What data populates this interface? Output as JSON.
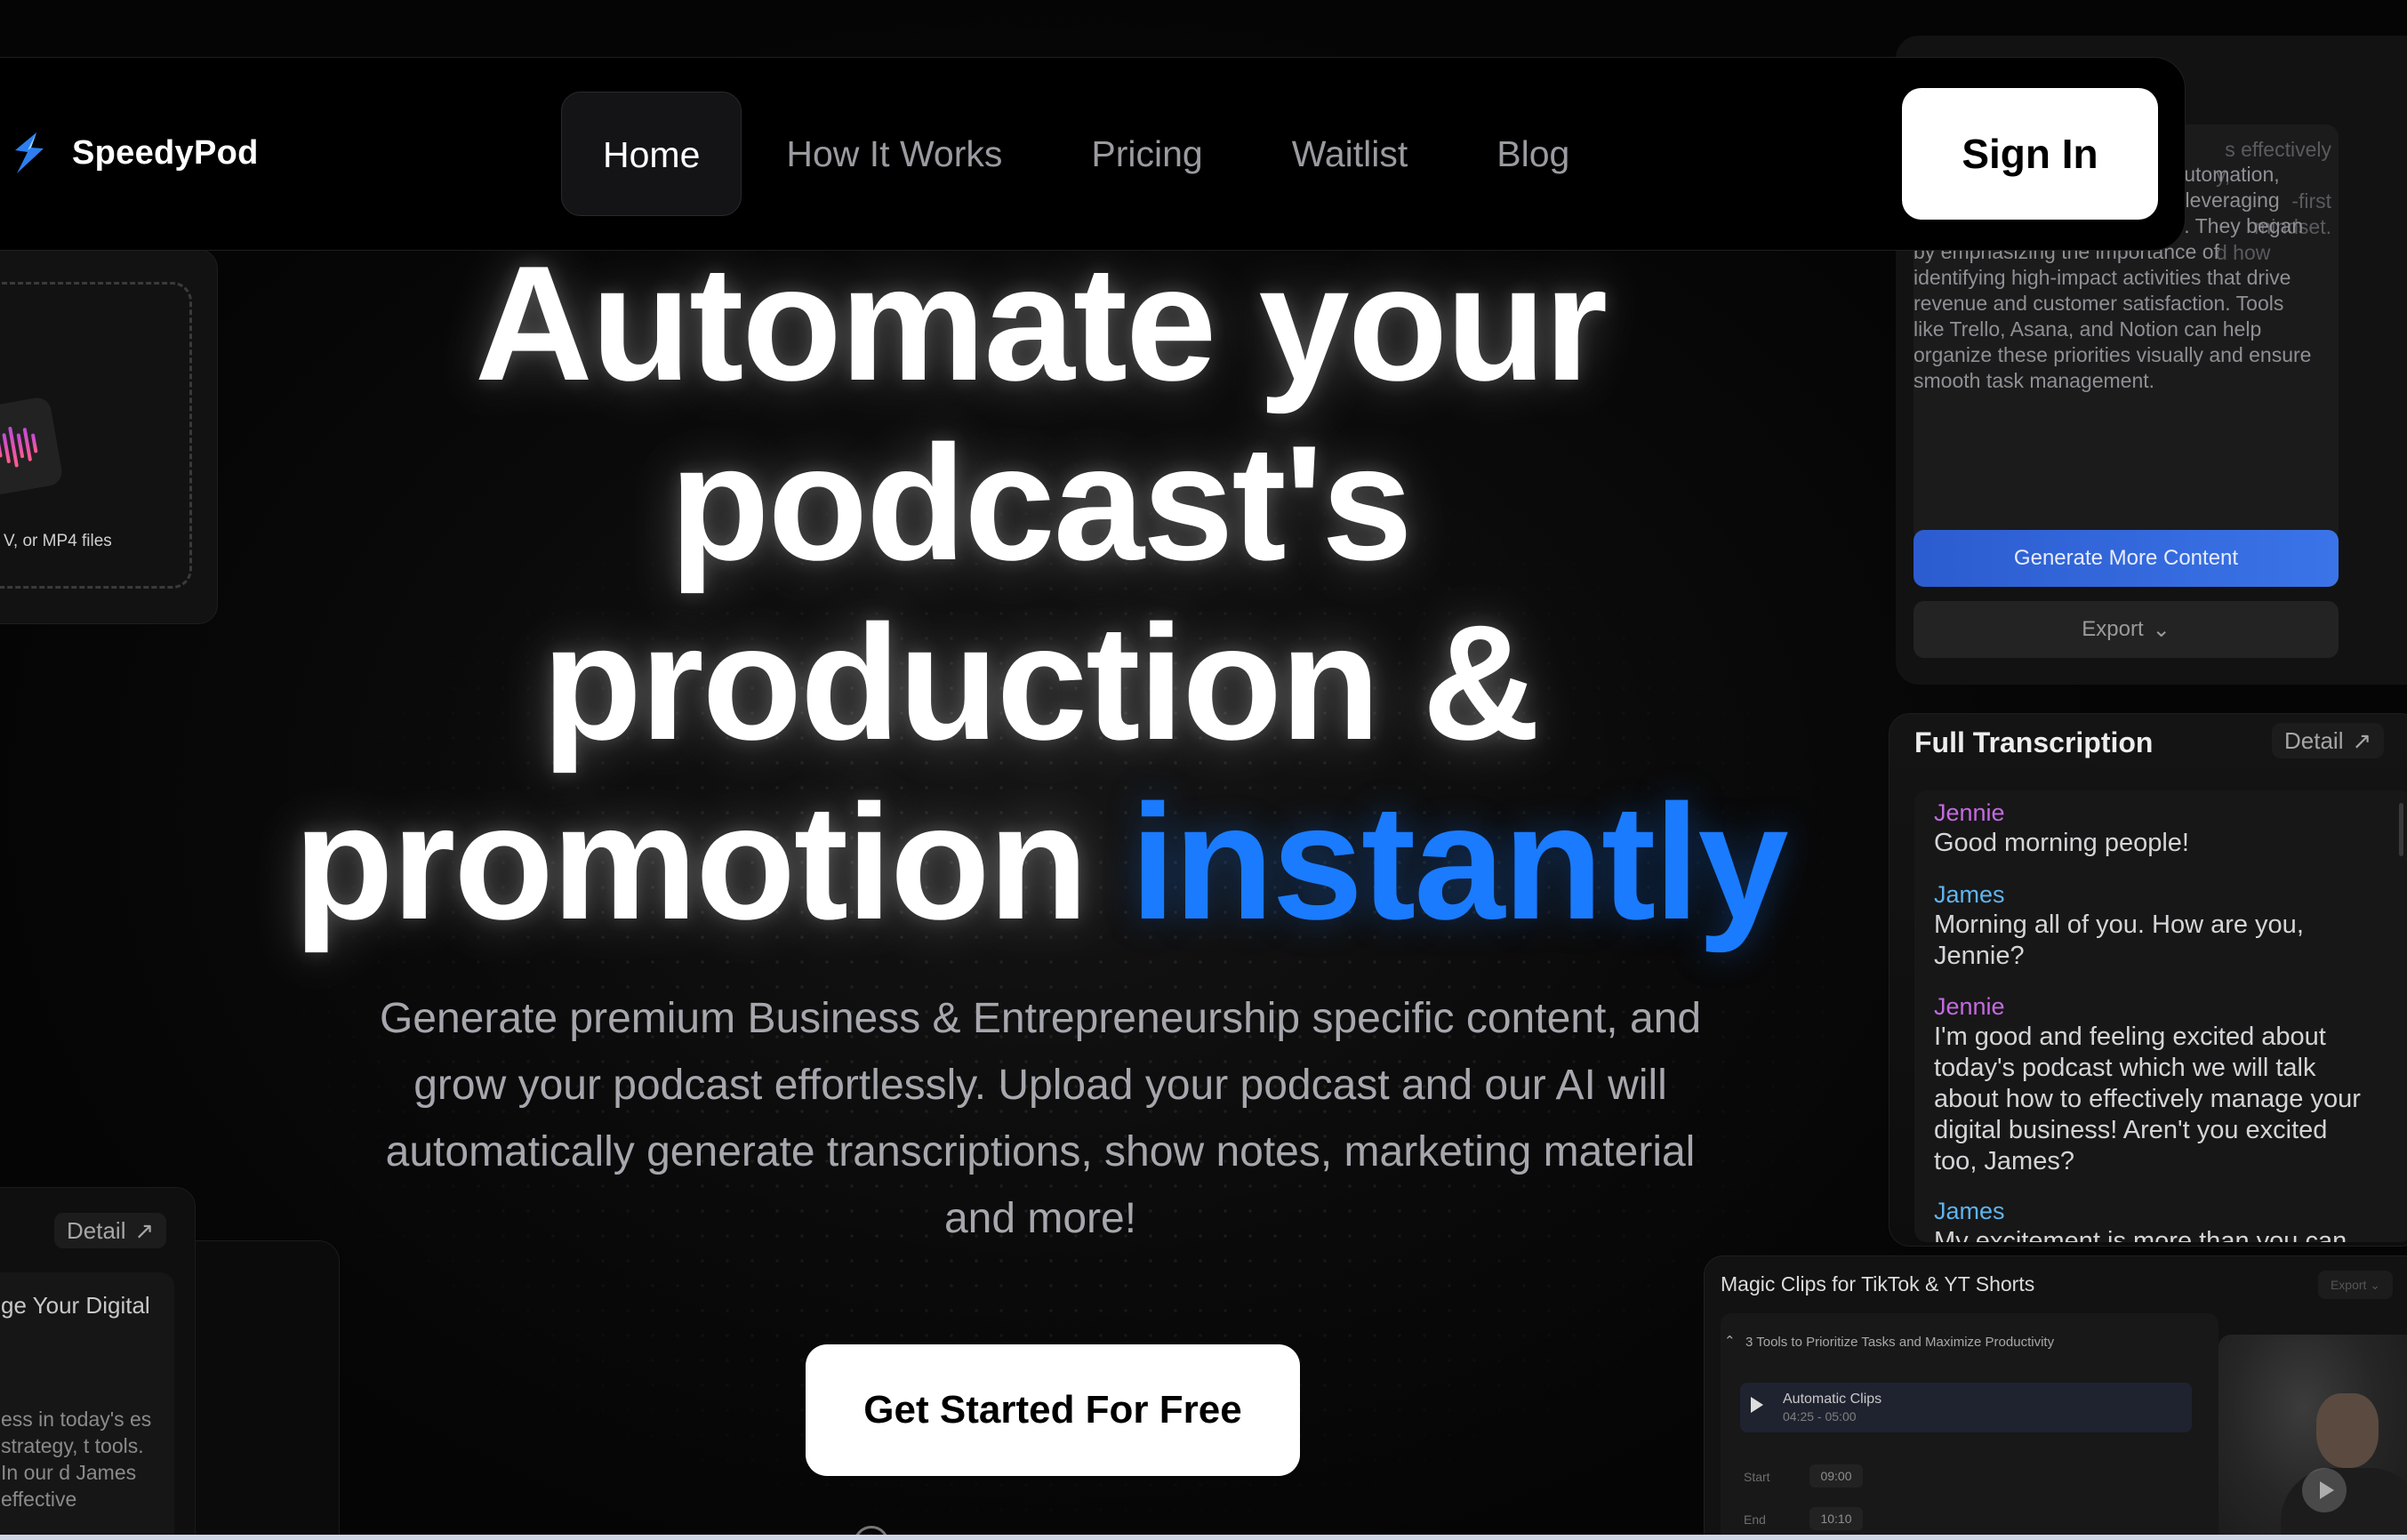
{
  "brand": {
    "name": "SpeedyPod",
    "logo_icon": "lightning-s-logo-icon"
  },
  "nav": {
    "items": [
      {
        "label": "Home",
        "active": true
      },
      {
        "label": "How It Works",
        "active": false
      },
      {
        "label": "Pricing",
        "active": false
      },
      {
        "label": "Waitlist",
        "active": false
      },
      {
        "label": "Blog",
        "active": false
      }
    ],
    "signin_label": "Sign In"
  },
  "hero": {
    "title_lines": [
      "Automate your",
      "podcast's",
      "production &",
      "promotion"
    ],
    "title_accent": "instantly",
    "subtitle": "Generate premium Business & Entrepreneurship specific content, and grow your podcast effortlessly. Upload your podcast and our AI will automatically generate transcriptions, show notes, marketing material and more!",
    "cta_label": "Get Started For Free"
  },
  "left_upload_card": {
    "text": "V, or MP4 files"
  },
  "left_detail_card": {
    "detail_label": "Detail",
    "title_fragment": "ge Your Digital",
    "body_fragment": "ess in today's es strategy, t tools. In our d James effective"
  },
  "content_card": {
    "text_fragments": [
      "s effectively",
      "y,",
      "-first mindset.",
      "d how"
    ],
    "body": "prioritizing tasks, embracing automation, managing remote teams, and leveraging data are essential for success. They began by emphasizing the importance of identifying high-impact activities that drive revenue and customer satisfaction. Tools like Trello, Asana, and Notion can help organize these priorities visually and ensure smooth task management.",
    "generate_label": "Generate More Content",
    "export_label": "Export"
  },
  "transcription": {
    "title": "Full Transcription",
    "detail_label": "Detail",
    "messages": [
      {
        "speaker": "Jennie",
        "text": "Good morning people!"
      },
      {
        "speaker": "James",
        "text": "Morning all of you. How are you, Jennie?"
      },
      {
        "speaker": "Jennie",
        "text": "I'm good and feeling excited about today's podcast which we will talk about how to effectively manage your digital business! Aren't you excited too, James?"
      },
      {
        "speaker": "James",
        "text": "My excitement is more than you can"
      }
    ]
  },
  "clips": {
    "title": "Magic Clips for TikTok & YT Shorts",
    "export_label": "Export",
    "episode": "3 Tools to Prioritize Tasks and Maximize Productivity",
    "clip_name": "Automatic Clips",
    "clip_range": "04:25 - 05:00",
    "start_label": "Start",
    "start_value": "09:00",
    "end_label": "End",
    "end_value": "10:10"
  },
  "colors": {
    "accent": "#1a7bff",
    "jennie": "#c26be0",
    "james": "#5fb4ef",
    "generate_button": "#3a74e8"
  }
}
